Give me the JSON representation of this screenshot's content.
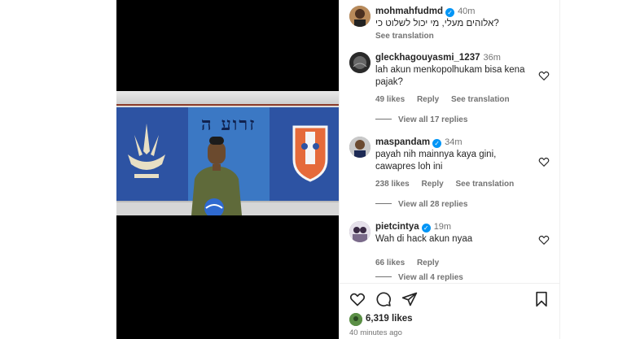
{
  "video": {
    "banner_text": "זרוע ה"
  },
  "caption": {
    "username": "mohmahfudmd",
    "verified": true,
    "time": "40m",
    "text": "?אלוהים מעלי, מי יכול לשלוט כי",
    "see_translation": "See translation"
  },
  "comments": [
    {
      "username": "gleckhagouyasmi_1237",
      "verified": false,
      "time": "36m",
      "text": "lah akun menkopolhukam bisa kena pajak?",
      "likes": "49 likes",
      "reply": "Reply",
      "see_translation": "See translation",
      "view_replies": "View all 17 replies"
    },
    {
      "username": "maspandam",
      "verified": true,
      "time": "34m",
      "text": "payah nih mainnya kaya gini, cawapres loh ini",
      "likes": "238 likes",
      "reply": "Reply",
      "see_translation": "See translation",
      "view_replies": "View all 28 replies"
    },
    {
      "username": "pietcintya",
      "verified": true,
      "time": "19m",
      "text": "Wah di hack akun nyaa",
      "likes": "66 likes",
      "reply": "Reply",
      "view_replies": "View all 4 replies"
    }
  ],
  "footer": {
    "likes": "6,319 likes",
    "ago": "40 minutes ago"
  },
  "icons": [
    "heart-icon",
    "comment-icon",
    "share-icon",
    "bookmark-icon",
    "mute-icon",
    "verified-icon"
  ],
  "colors": {
    "verified": "#0095f6",
    "muted_text": "#737373"
  }
}
